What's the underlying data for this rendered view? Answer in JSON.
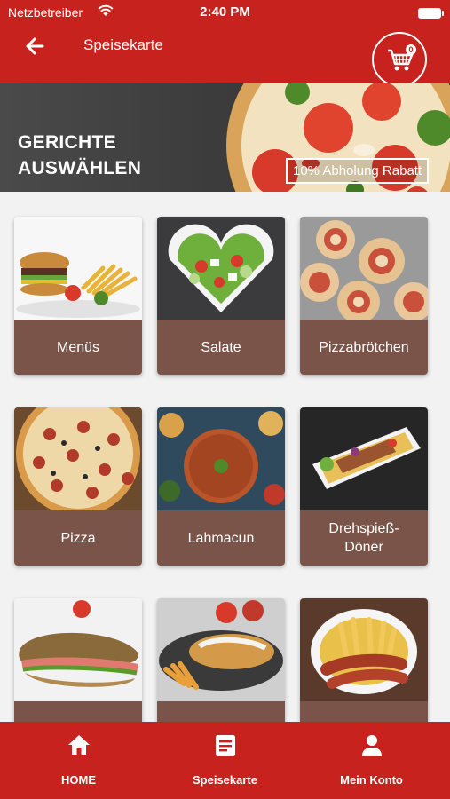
{
  "status_bar": {
    "carrier": "Netzbetreiber",
    "time": "2:40 PM"
  },
  "header": {
    "title": "Speisekarte",
    "back_icon": "arrow-left-icon",
    "cart_icon": "cart-icon",
    "cart_count": "0"
  },
  "banner": {
    "title_line1": "GERICHTE",
    "title_line2": "AUSWÄHLEN",
    "discount": "10% Abholung Rabatt"
  },
  "categories": [
    {
      "label": "Menüs"
    },
    {
      "label": "Salate"
    },
    {
      "label": "Pizzabrötchen"
    },
    {
      "label": "Pizza"
    },
    {
      "label": "Lahmacun"
    },
    {
      "label": "Drehspieß-Döner"
    },
    {
      "label": ""
    },
    {
      "label": ""
    },
    {
      "label": ""
    }
  ],
  "bottom_nav": [
    {
      "label": "HOME",
      "icon": "home-icon"
    },
    {
      "label": "Speisekarte",
      "icon": "menu-list-icon"
    },
    {
      "label": "Mein Konto",
      "icon": "person-icon"
    }
  ],
  "colors": {
    "primary": "#c8221e",
    "card_label_bg": "#7a5448",
    "background": "#f2f2f2"
  }
}
